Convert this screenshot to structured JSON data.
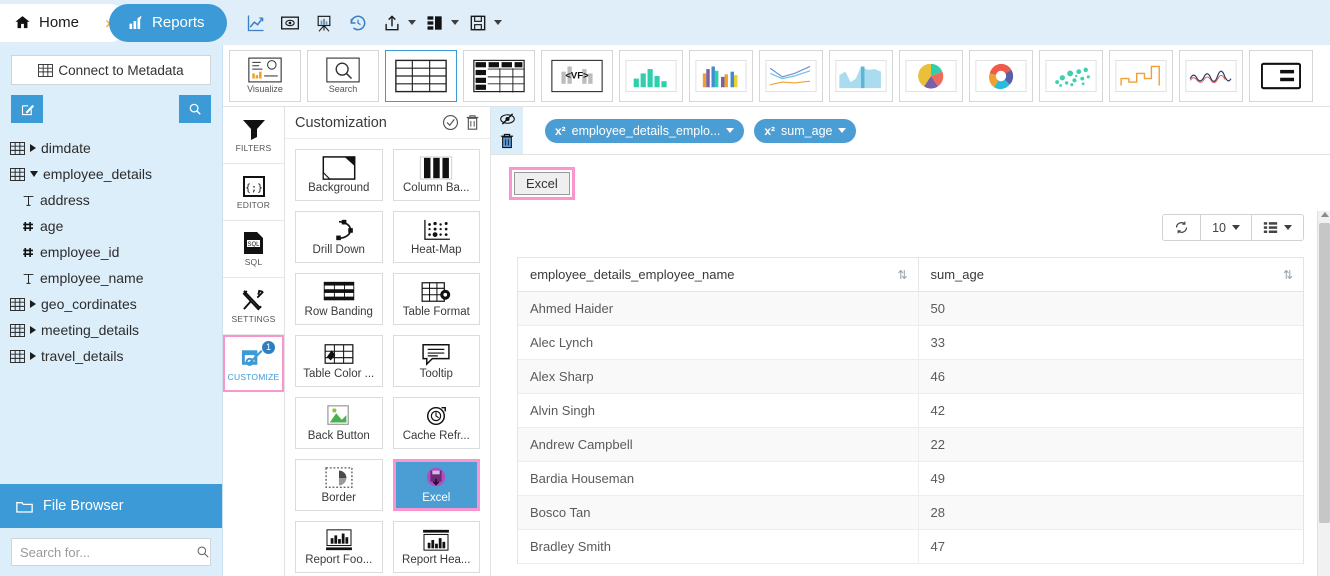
{
  "header": {
    "home_label": "Home",
    "separator": "›",
    "reports_label": "Reports",
    "icons": [
      {
        "name": "line-chart-icon",
        "title": "Chart"
      },
      {
        "name": "preview-eye-icon",
        "title": "Preview"
      },
      {
        "name": "easel-chart-icon",
        "title": "Presentation"
      },
      {
        "name": "history-clock-icon",
        "title": "History"
      },
      {
        "name": "share-upload-icon",
        "title": "Share"
      },
      {
        "name": "layout-icon",
        "title": "Layout"
      },
      {
        "name": "save-disk-icon",
        "title": "Save"
      }
    ]
  },
  "sidebar": {
    "connect_label": "Connect to Metadata",
    "edit_icon": "edit-icon",
    "search_icon": "search-icon",
    "tree": [
      {
        "label": "dimdate",
        "type": "table",
        "expanded": false,
        "level": 0
      },
      {
        "label": "employee_details",
        "type": "table",
        "expanded": true,
        "level": 0
      },
      {
        "label": "address",
        "type": "text",
        "level": 1
      },
      {
        "label": "age",
        "type": "number",
        "level": 1
      },
      {
        "label": "employee_id",
        "type": "number",
        "level": 1
      },
      {
        "label": "employee_name",
        "type": "text",
        "level": 1
      },
      {
        "label": "geo_cordinates",
        "type": "table",
        "expanded": false,
        "level": 0
      },
      {
        "label": "meeting_details",
        "type": "table",
        "expanded": false,
        "level": 0
      },
      {
        "label": "travel_details",
        "type": "table",
        "expanded": false,
        "level": 0
      }
    ],
    "file_browser_label": "File Browser",
    "search_placeholder": "Search for..."
  },
  "chart_types": [
    {
      "label": "Visualize",
      "name": "visualize-tile",
      "selected": false
    },
    {
      "label": "Search",
      "name": "search-tile",
      "selected": false
    },
    {
      "label": "",
      "name": "table-tile",
      "selected": true
    },
    {
      "label": "",
      "name": "summary-table-tile",
      "selected": false
    },
    {
      "label": "",
      "name": "vf-tile",
      "selected": false
    },
    {
      "label": "",
      "name": "bar-chart-tile",
      "selected": false
    },
    {
      "label": "",
      "name": "multi-bar-chart-tile",
      "selected": false
    },
    {
      "label": "",
      "name": "line-chart-tile",
      "selected": false
    },
    {
      "label": "",
      "name": "area-chart-tile",
      "selected": false
    },
    {
      "label": "",
      "name": "pie-chart-tile",
      "selected": false
    },
    {
      "label": "",
      "name": "donut-chart-tile",
      "selected": false
    },
    {
      "label": "",
      "name": "bubble-chart-tile",
      "selected": false
    },
    {
      "label": "",
      "name": "step-chart-tile",
      "selected": false
    },
    {
      "label": "",
      "name": "spline-chart-tile",
      "selected": false
    },
    {
      "label": "",
      "name": "text-card-tile",
      "selected": false
    }
  ],
  "rail": [
    {
      "label": "FILTERS",
      "name": "sidebar-item-filters",
      "active": false
    },
    {
      "label": "EDITOR",
      "name": "sidebar-item-editor",
      "active": false
    },
    {
      "label": "SQL",
      "name": "sidebar-item-sql",
      "active": false
    },
    {
      "label": "SETTINGS",
      "name": "sidebar-item-settings",
      "active": false
    },
    {
      "label": "CUSTOMIZE",
      "name": "sidebar-item-customize",
      "active": true,
      "badge": "1"
    }
  ],
  "customization": {
    "title": "Customization",
    "apply_icon": "check-circle-icon",
    "delete_icon": "trash-icon",
    "tiles": [
      {
        "label": "Background",
        "name": "background-tile",
        "selected": false
      },
      {
        "label": "Column Ba...",
        "name": "column-bar-tile",
        "selected": false
      },
      {
        "label": "Drill Down",
        "name": "drill-down-tile",
        "selected": false
      },
      {
        "label": "Heat-Map",
        "name": "heat-map-tile",
        "selected": false
      },
      {
        "label": "Row Banding",
        "name": "row-banding-tile",
        "selected": false
      },
      {
        "label": "Table Format",
        "name": "table-format-tile",
        "selected": false
      },
      {
        "label": "Table Color ...",
        "name": "table-color-tile",
        "selected": false
      },
      {
        "label": "Tooltip",
        "name": "tooltip-tile",
        "selected": false
      },
      {
        "label": "Back Button",
        "name": "back-button-tile",
        "selected": false
      },
      {
        "label": "Cache Refr...",
        "name": "cache-refresh-tile",
        "selected": false
      },
      {
        "label": "Border",
        "name": "border-tile",
        "selected": false
      },
      {
        "label": "Excel",
        "name": "excel-tile",
        "selected": true
      },
      {
        "label": "Report Foo...",
        "name": "report-footer-tile",
        "selected": false
      },
      {
        "label": "Report Hea...",
        "name": "report-header-tile",
        "selected": false
      }
    ]
  },
  "report": {
    "hide_icon": "eye-slash-icon",
    "delete_icon": "trash-icon",
    "chips": [
      {
        "label": "employee_details_emplo...",
        "prefix": "x²",
        "name": "chip-employee-name"
      },
      {
        "label": "sum_age",
        "prefix": "x²",
        "name": "chip-sum-age"
      }
    ],
    "excel_button_label": "Excel",
    "toolbar": {
      "refresh_icon": "refresh-icon",
      "page_size": "10",
      "columns_icon": "columns-icon"
    }
  },
  "chart_data": {
    "type": "table",
    "title": "",
    "columns": [
      "employee_details_employee_name",
      "sum_age"
    ],
    "rows": [
      [
        "Ahmed Haider",
        "50"
      ],
      [
        "Alec Lynch",
        "33"
      ],
      [
        "Alex Sharp",
        "46"
      ],
      [
        "Alvin Singh",
        "42"
      ],
      [
        "Andrew Campbell",
        "22"
      ],
      [
        "Bardia Houseman",
        "49"
      ],
      [
        "Bosco Tan",
        "28"
      ],
      [
        "Bradley Smith",
        "47"
      ]
    ],
    "categories": [
      "Ahmed Haider",
      "Alec Lynch",
      "Alex Sharp",
      "Alvin Singh",
      "Andrew Campbell",
      "Bardia Houseman",
      "Bosco Tan",
      "Bradley Smith"
    ],
    "values": [
      50,
      33,
      46,
      42,
      22,
      49,
      28,
      47
    ],
    "xlabel": "employee_details_employee_name",
    "ylabel": "sum_age"
  },
  "colors": {
    "accent": "#3c9ad6",
    "header_bg": "#dfeef8",
    "sidebar_bg": "#dbeefa",
    "highlight_pink": "#f995cf",
    "excel_tile_bg": "#4a9ed4"
  }
}
